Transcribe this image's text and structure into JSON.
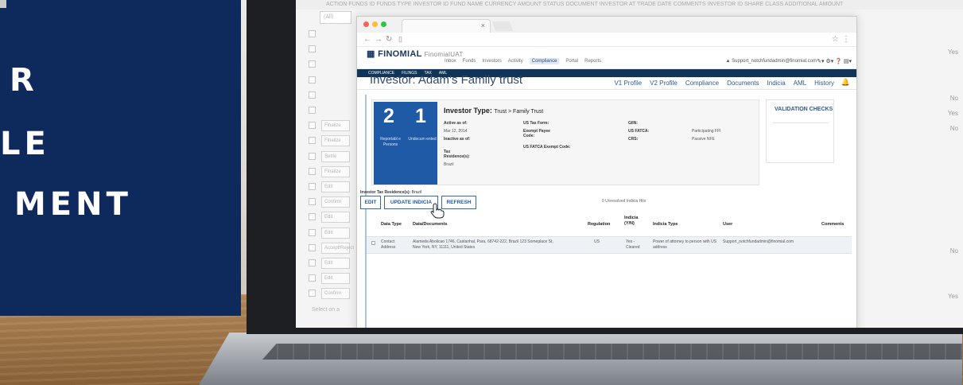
{
  "overlay": {
    "lines": [
      "R",
      "LE",
      "MENT"
    ],
    "background": "#0e2a5c"
  },
  "background_app": {
    "header_text": "ACTION   FUNDS ID   FUNDS TYPE  INVESTOR ID  FUND NAME  CURRENCY   AMOUNT     STATUS    DOCUMENT  INVESTOR AT  TRADE DATE  COMMENTS  INVESTOR ID  SHARE CLASS  ADDITIONAL  AMOUNT",
    "filter_value": "(All)",
    "row_buttons": [
      "Finalize",
      "Finalize",
      "Settle",
      "Finalize",
      "Edit",
      "Confirm",
      "Edit",
      "Edit",
      "Accept/Reject",
      "Edit",
      "Edit",
      "Confirm"
    ],
    "right_values": [
      {
        "text": "Yes",
        "row": 1
      },
      {
        "text": "No",
        "row": 4
      },
      {
        "text": "Yes",
        "row": 5
      },
      {
        "text": "No",
        "row": 6
      },
      {
        "text": "No",
        "row": 14
      },
      {
        "text": "Yes",
        "row": 17
      }
    ],
    "footer_text": "Select on a"
  },
  "browser": {
    "tab_close": "×",
    "brand_name": "FINOMIAL",
    "brand_env": "FinomialUAT",
    "topnav": [
      "Inbox",
      "Funds",
      "Investors",
      "Activity",
      "Compliance",
      "Portal",
      "Reports"
    ],
    "topnav_active_index": 4,
    "user": "Support_notchfundadmin@finomial.com",
    "subnav": [
      "COMPLIANCE",
      "FILINGS",
      "TAX",
      "AML"
    ],
    "page_title": "Investor: Adam's Family trust",
    "page_links": [
      "V1 Profile",
      "V2 Profile",
      "Compliance",
      "Documents",
      "Indicia",
      "AML",
      "History"
    ]
  },
  "summary": {
    "count_reportable": "2",
    "count_undocumented": "1",
    "label_reportable": "Reportabl e Persons",
    "label_undocumented": "Undocum ented",
    "investor_type_label": "Investor Type:",
    "investor_type_value": "Trust > Family Trust",
    "active_as_of_label": "Active as of:",
    "active_as_of_value": "Mar 12, 2014",
    "inactive_as_of_label": "Inactive as of:",
    "tax_residence_label": "Tax Residence(s):",
    "tax_residence_value": "Brazil",
    "us_tax_form_label": "US Tax Form:",
    "exempt_payee_label": "Exempt Payee Code:",
    "us_fatca_exempt_label": "US FATCA Exempt Code:",
    "giin_label": "GIIN:",
    "us_fatca_label": "US FATCA:",
    "us_fatca_value": "Participating FFI",
    "crs_label": "CRS:",
    "crs_value": "Passive NFE",
    "validation_title": "VALIDATION CHECKS"
  },
  "actions": {
    "tax_residence_label": "Investor Tax Residence(s):",
    "tax_residence_value": "Brazil",
    "edit": "EDIT",
    "update_indicia": "UPDATE INDICIA",
    "refresh": "REFRESH",
    "unresolved_hits": "0 Unresolved Indicia Hits"
  },
  "table": {
    "headers": [
      "Data Type",
      "Data/Documents",
      "Regulation",
      "Indicia (Y/N)",
      "Indicia Type",
      "User",
      "Comments"
    ],
    "rows": [
      {
        "data_type": "Contact Address",
        "documents": "Alameda Abolicao 1746, Castanhal, Para, 68742-222, Brazil 123 Someplace St, New York, NY, 11111, United States",
        "regulation": "US",
        "indicia": "Yes - Cleared",
        "indicia_type": "Power of attorney to person with US address",
        "user": "Support_notchfundadmin@finomial.com",
        "comments": ""
      }
    ]
  }
}
